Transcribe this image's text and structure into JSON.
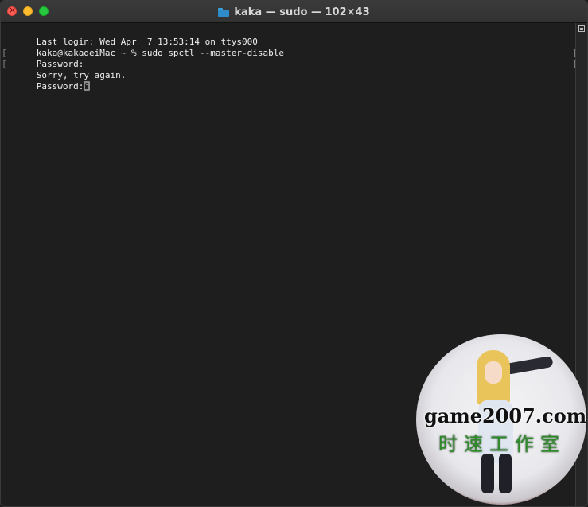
{
  "window": {
    "title": "kaka — sudo — 102×43"
  },
  "terminal": {
    "lines": [
      {
        "text": "Last login: Wed Apr  7 13:53:14 on ttys000",
        "mark_left": "",
        "mark_right": ""
      },
      {
        "text": "kaka@kakadeiMac ~ % sudo spctl --master-disable",
        "mark_left": "[",
        "mark_right": "]"
      },
      {
        "text": "Password:",
        "mark_left": "[",
        "mark_right": "]"
      },
      {
        "text": "Sorry, try again.",
        "mark_left": "",
        "mark_right": ""
      },
      {
        "text": "Password:",
        "mark_left": "",
        "mark_right": ""
      }
    ],
    "cursor_icon": "key-cursor-icon"
  },
  "watermark": {
    "site": "game2007.com",
    "chinese": "时速工作室"
  },
  "colors": {
    "background": "#1e1e1e",
    "text": "#f0f0f0",
    "close": "#ff5f57",
    "minimize": "#febc2e",
    "maximize": "#28c840"
  }
}
